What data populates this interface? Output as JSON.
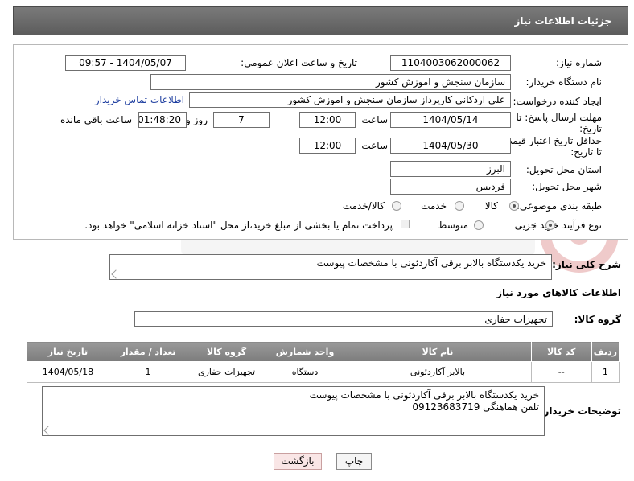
{
  "header": {
    "title": "جزئیات اطلاعات نیاز"
  },
  "form": {
    "need_number_label": "شماره نیاز:",
    "need_number": "1104003062000062",
    "announce_label": "تاریخ و ساعت اعلان عمومی:",
    "announce_value": "1404/05/07 - 09:57",
    "buyer_org_label": "نام دستگاه خریدار:",
    "buyer_org": "سازمان سنجش و اموزش کشور",
    "creator_label": "ایجاد کننده درخواست:",
    "creator": "علی اردکانی کارپرداز سازمان سنجش و اموزش کشور",
    "contact_link": "اطلاعات تماس خریدار",
    "deadline_label_1": "مهلت ارسال پاسخ: تا",
    "deadline_label_2": "تاریخ:",
    "deadline_date": "1404/05/14",
    "hour_label": "ساعت",
    "deadline_time": "12:00",
    "days_value": "7",
    "days_label": "روز و",
    "remaining_time": "01:48:20",
    "remaining_label": "ساعت باقی مانده",
    "validity_label_1": "حداقل تاریخ اعتبار قیمت:",
    "validity_label_2": "تا تاریخ:",
    "validity_date": "1404/05/30",
    "validity_time": "12:00",
    "province_label": "استان محل تحویل:",
    "province": "البرز",
    "city_label": "شهر محل تحویل:",
    "city": "فردیس",
    "category_label": "طبقه بندی موضوعی:",
    "category_options": [
      "کالا",
      "خدمت",
      "کالا/خدمت"
    ],
    "category_selected": "کالا",
    "process_label": "نوع فرآیند خرید :",
    "process_options": [
      "جزیی",
      "متوسط"
    ],
    "process_selected": "جزیی",
    "payment_note": "پرداخت تمام یا بخشی از مبلغ خرید،از محل \"اسناد خزانه اسلامی\" خواهد بود."
  },
  "description": {
    "label": "شرح کلی نیاز:",
    "text": "خرید یکدستگاه بالابر برقی آکاردئونی با مشخصات پیوست"
  },
  "goods": {
    "section_title": "اطلاعات کالاهای مورد نیاز",
    "group_label": "گروه کالا:",
    "group_value": "تجهیزات حفاری",
    "columns": [
      "ردیف",
      "کد کالا",
      "نام کالا",
      "واحد شمارش",
      "گروه کالا",
      "تعداد / مقدار",
      "تاریخ نیاز"
    ],
    "rows": [
      [
        "1",
        "--",
        "بالابر آکاردئونی",
        "دستگاه",
        "تجهیزات حفاری",
        "1",
        "1404/05/18"
      ]
    ]
  },
  "buyer_notes": {
    "label": "توضیحات خریدار:",
    "line1": "خرید یکدستگاه بالابر برقی آکاردئونی با مشخصات پیوست",
    "line2": "تلفن هماهنگی 09123683719"
  },
  "buttons": {
    "print": "چاپ",
    "back": "بازگشت"
  },
  "colors": {
    "header_bg": "#6b6b6b",
    "link": "#1f3fa0",
    "back_button_bg": "#f9e6e6"
  }
}
